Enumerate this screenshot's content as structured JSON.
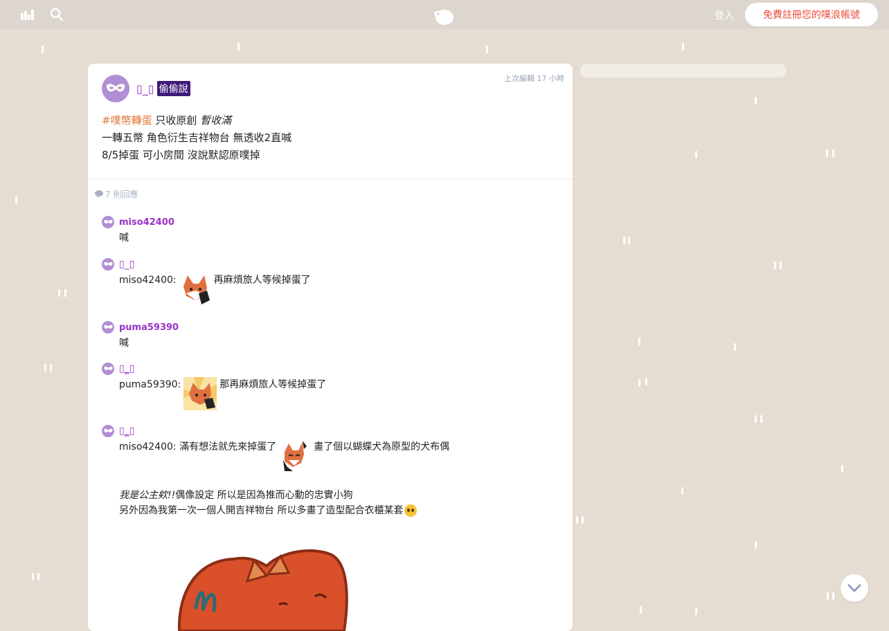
{
  "topbar": {
    "login_label": "登入",
    "signup_label": "免費註冊您的噗浪帳號"
  },
  "post": {
    "author": "▯_▯",
    "anon_badge": "偷偷說",
    "edited": "上次編輯 17 小時",
    "hashtag": "#噗幣轉蛋",
    "line1_rest": " 只收原創 ",
    "line1_italic": "暫收滿",
    "line2": "一轉五幣 角色衍生吉祥物台 無透收2直喊",
    "line3": "8/5掉蛋 可小房間 沒說默認原噗掉",
    "response_count": "7 則回應"
  },
  "responses": [
    {
      "name": "miso42400",
      "text": "喊"
    },
    {
      "name": "▯_▯",
      "prefix": "miso42400:",
      "text": "再麻煩旅人等候掉蛋了"
    },
    {
      "name": "puma59390",
      "text": "喊"
    },
    {
      "name": "▯_▯",
      "prefix": "puma59390:",
      "text": "那再麻煩旅人等候掉蛋了"
    },
    {
      "name": "▯_▯",
      "prefix": "miso42400: 滿有想法就先來掉蛋了",
      "text": "畫了個以蝴蝶犬為原型的犬布偶",
      "italic": "我是公主欸!!",
      "line2_rest": "偶像設定 所以是因為推而心動的忠實小狗",
      "line3": "另外因為我第一次一個人開吉祥物台 所以多畫了造型配合衣櫃某套"
    }
  ],
  "colors": {
    "background": "#e6ddd2",
    "topbar": "#dcd6ce",
    "accent_purple": "#9a32c7",
    "avatar": "#b18fd4",
    "hashtag": "#e07838",
    "signup_text": "#ee4b38"
  },
  "icons": [
    "bar-chart-icon",
    "search-icon",
    "plurk-logo-icon",
    "mask-icon",
    "comment-icon",
    "chevron-down-icon"
  ]
}
